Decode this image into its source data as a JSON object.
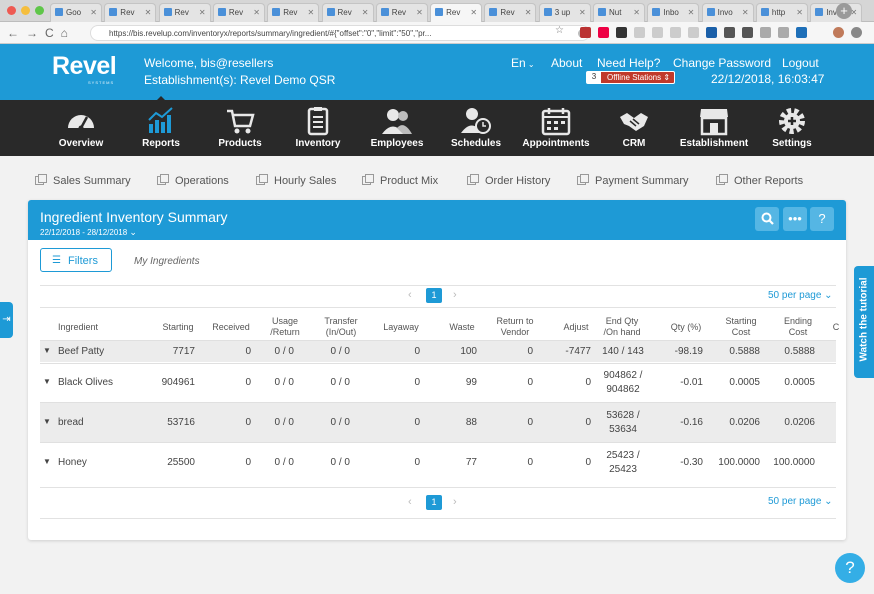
{
  "browser": {
    "tabs": [
      "Goo",
      "Rev",
      "Rev",
      "Rev",
      "Rev",
      "Rev",
      "Rev",
      "Rev",
      "Rev",
      "3 up",
      "Nut",
      "Inbo",
      "Invo",
      "http",
      "Inve"
    ],
    "active_tab_index": 7,
    "url": "https://bis.revelup.com/inventoryx/reports/summary/ingredient/#{\"offset\":\"0\",\"limit\":\"50\",\"pr..."
  },
  "header": {
    "logo": "Revel",
    "logo_sub": "SYSTEMS",
    "welcome": "Welcome, bis@resellers",
    "establishment": "Establishment(s): Revel Demo QSR",
    "language": "En",
    "links": [
      "About",
      "Need Help?",
      "Change Password",
      "Logout"
    ],
    "offline_count": "3",
    "offline_label": "Offline Stations",
    "datetime": "22/12/2018, 16:03:47"
  },
  "nav": {
    "items": [
      "Overview",
      "Reports",
      "Products",
      "Inventory",
      "Employees",
      "Schedules",
      "Appointments",
      "CRM",
      "Establishment",
      "Settings"
    ],
    "active": "Reports"
  },
  "subnav": {
    "items": [
      "Sales Summary",
      "Operations",
      "Hourly Sales",
      "Product Mix",
      "Order History",
      "Payment Summary",
      "Other Reports"
    ]
  },
  "panel": {
    "title": "Ingredient Inventory Summary",
    "date_range": "22/12/2018 - 28/12/2018",
    "filters_label": "Filters",
    "my_ingredients_label": "My Ingredients",
    "page": "1",
    "per_page": "50 per page",
    "columns": [
      [
        "Ingredient"
      ],
      [
        "Starting"
      ],
      [
        "Received"
      ],
      [
        "Usage",
        "/Return"
      ],
      [
        "Transfer",
        "(In/Out)"
      ],
      [
        "Layaway"
      ],
      [
        "Waste"
      ],
      [
        "Return to",
        "Vendor"
      ],
      [
        "Adjust"
      ],
      [
        "End Qty",
        "/On hand"
      ],
      [
        "Qty (%)"
      ],
      [
        "Starting",
        "Cost"
      ],
      [
        "Ending",
        "Cost"
      ],
      [
        "C"
      ]
    ],
    "rows": [
      {
        "name": "Beef Patty",
        "starting": "7717",
        "received": "0",
        "usage": "0 / 0",
        "transfer": "0 / 0",
        "layaway": "0",
        "waste": "100",
        "return_vendor": "0",
        "adjust": "-7477",
        "end_qty": [
          "140 / 143"
        ],
        "qty_pct": "-98.19",
        "starting_cost": "0.5888",
        "ending_cost": "0.5888"
      },
      {
        "name": "Black Olives",
        "starting": "904961",
        "received": "0",
        "usage": "0 / 0",
        "transfer": "0 / 0",
        "layaway": "0",
        "waste": "99",
        "return_vendor": "0",
        "adjust": "0",
        "end_qty": [
          "904862 /",
          "904862"
        ],
        "qty_pct": "-0.01",
        "starting_cost": "0.0005",
        "ending_cost": "0.0005"
      },
      {
        "name": "bread",
        "starting": "53716",
        "received": "0",
        "usage": "0 / 0",
        "transfer": "0 / 0",
        "layaway": "0",
        "waste": "88",
        "return_vendor": "0",
        "adjust": "0",
        "end_qty": [
          "53628 /",
          "53634"
        ],
        "qty_pct": "-0.16",
        "starting_cost": "0.0206",
        "ending_cost": "0.0206"
      },
      {
        "name": "Honey",
        "starting": "25500",
        "received": "0",
        "usage": "0 / 0",
        "transfer": "0 / 0",
        "layaway": "0",
        "waste": "77",
        "return_vendor": "0",
        "adjust": "0",
        "end_qty": [
          "25423 /",
          "25423"
        ],
        "qty_pct": "-0.30",
        "starting_cost": "100.0000",
        "ending_cost": "100.0000"
      }
    ]
  },
  "tutorial_label": "Watch the tutorial",
  "help_label": "?"
}
